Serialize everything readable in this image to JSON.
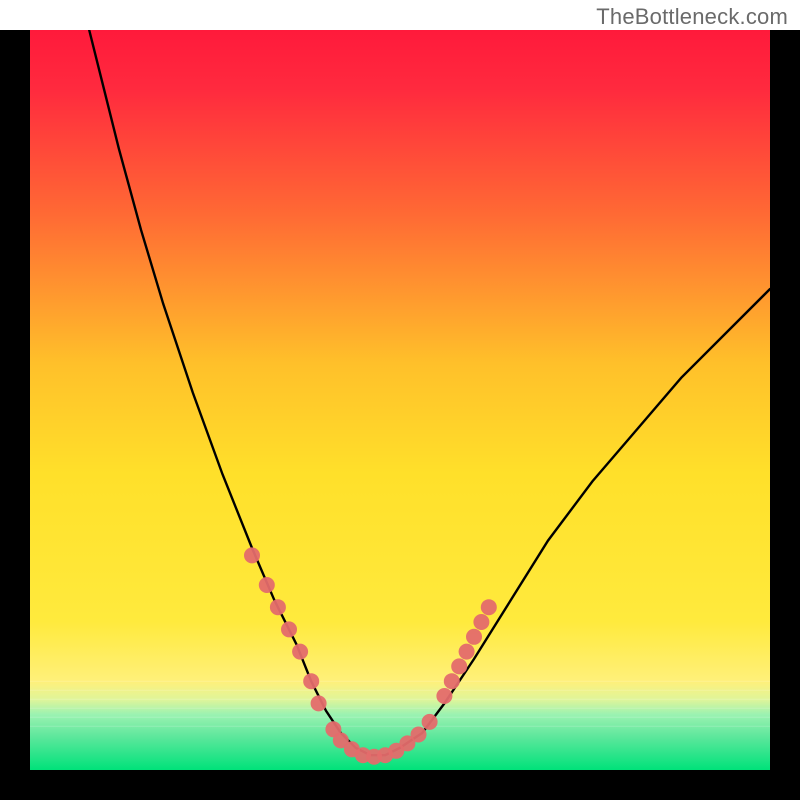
{
  "watermark": "TheBottleneck.com",
  "colors": {
    "topRed": "#ff1a3b",
    "orange": "#ff8a28",
    "yellow": "#ffe02a",
    "paleYellow": "#fff07a",
    "mintBand": "#9bf2b1",
    "bottomGreen": "#00e27a",
    "curve": "#000000",
    "markers": "#e46b6b",
    "frame": "#000000"
  },
  "chart_data": {
    "type": "line",
    "title": "",
    "xlabel": "",
    "ylabel": "",
    "xlim": [
      0,
      100
    ],
    "ylim": [
      0,
      100
    ],
    "grid": false,
    "legend": false,
    "series": [
      {
        "name": "bottleneck-curve",
        "x": [
          8,
          10,
          12,
          15,
          18,
          22,
          26,
          30,
          33,
          36,
          38,
          40,
          42,
          44,
          46,
          48,
          50,
          53,
          56,
          60,
          65,
          70,
          76,
          82,
          88,
          94,
          100
        ],
        "y": [
          100,
          92,
          84,
          73,
          63,
          51,
          40,
          30,
          23,
          17,
          12,
          8,
          5,
          3,
          2,
          2,
          3,
          5,
          9,
          15,
          23,
          31,
          39,
          46,
          53,
          59,
          65
        ]
      }
    ],
    "markers": [
      {
        "x": 30,
        "y": 29
      },
      {
        "x": 32,
        "y": 25
      },
      {
        "x": 33.5,
        "y": 22
      },
      {
        "x": 35,
        "y": 19
      },
      {
        "x": 36.5,
        "y": 16
      },
      {
        "x": 38,
        "y": 12
      },
      {
        "x": 39,
        "y": 9
      },
      {
        "x": 41,
        "y": 5.5
      },
      {
        "x": 42,
        "y": 4
      },
      {
        "x": 43.5,
        "y": 2.8
      },
      {
        "x": 45,
        "y": 2
      },
      {
        "x": 46.5,
        "y": 1.8
      },
      {
        "x": 48,
        "y": 2
      },
      {
        "x": 49.5,
        "y": 2.6
      },
      {
        "x": 51,
        "y": 3.6
      },
      {
        "x": 52.5,
        "y": 4.8
      },
      {
        "x": 54,
        "y": 6.5
      },
      {
        "x": 56,
        "y": 10
      },
      {
        "x": 57,
        "y": 12
      },
      {
        "x": 58,
        "y": 14
      },
      {
        "x": 59,
        "y": 16
      },
      {
        "x": 60,
        "y": 18
      },
      {
        "x": 61,
        "y": 20
      },
      {
        "x": 62,
        "y": 22
      }
    ]
  }
}
